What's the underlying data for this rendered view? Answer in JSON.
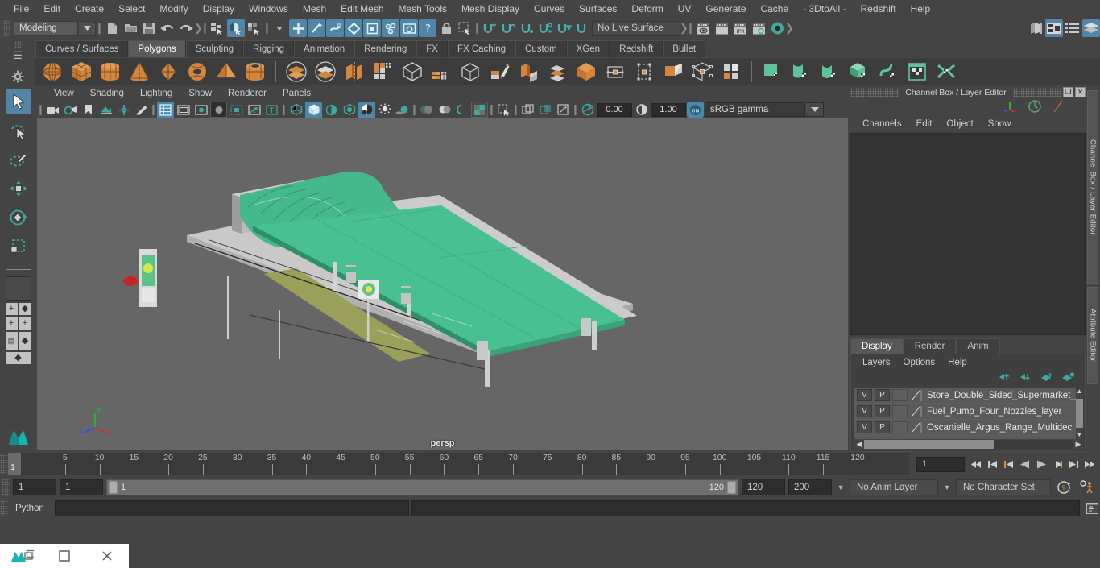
{
  "menubar": {
    "items": [
      "File",
      "Edit",
      "Create",
      "Select",
      "Modify",
      "Display",
      "Windows",
      "Mesh",
      "Edit Mesh",
      "Mesh Tools",
      "Mesh Display",
      "Curves",
      "Surfaces",
      "Deform",
      "UV",
      "Generate",
      "Cache",
      "- 3DtoAll -",
      "Redshift",
      "Help"
    ]
  },
  "statusline": {
    "mode": "Modeling",
    "live_surface": "No Live Surface",
    "icons": [
      "new-scene-icon",
      "open-scene-icon",
      "save-scene-icon",
      "undo-icon",
      "redo-icon",
      "select-hierarchy-icon",
      "select-object-icon",
      "select-component-icon",
      "snap-grid-icon",
      "snap-curve-icon",
      "snap-point-icon",
      "snap-projected-icon",
      "snap-view-plane-icon",
      "magnet-icon",
      "construction-history-icon",
      "lock-icon",
      "make-live-icon",
      "render-current-frame-icon",
      "ipr-render-icon",
      "render-settings-icon",
      "hypershade-icon",
      "render-view-icon",
      "show-hide-editors-icon",
      "channel-box-icon",
      "attribute-editor-icon",
      "tool-settings-icon",
      "modeling-toolkit-icon"
    ]
  },
  "shelf": {
    "tabs": [
      "Curves / Surfaces",
      "Polygons",
      "Sculpting",
      "Rigging",
      "Animation",
      "Rendering",
      "FX",
      "FX Caching",
      "Custom",
      "XGen",
      "Redshift",
      "Bullet"
    ],
    "active_tab": "Polygons",
    "buttons": [
      "poly-sphere-icon",
      "poly-cube-icon",
      "poly-cylinder-icon",
      "poly-cone-icon",
      "poly-plane-icon",
      "poly-torus-icon",
      "poly-pyramid-icon",
      "poly-pipe-icon",
      "boolean-union-icon",
      "boolean-difference-icon",
      "combine-icon",
      "mirror-icon",
      "smooth-icon",
      "extrude-icon",
      "bevel-icon",
      "multicut-icon",
      "bridge-icon",
      "fill-hole-icon",
      "quad-draw-icon",
      "target-weld-icon",
      "append-polygon-icon",
      "insert-edge-loop-icon",
      "offset-edge-loop-icon",
      "connect-icon",
      "detach-icon",
      "duplicate-face-icon",
      "uv-plane-icon",
      "uv-cylinder-icon",
      "uv-sphere-icon",
      "uv-cube-icon",
      "uv-contour-icon",
      "uv-editor-icon",
      "uv-unfold-icon"
    ]
  },
  "toolbox": {
    "tools": [
      "select-tool-icon",
      "lasso-select-tool-icon",
      "paint-select-tool-icon",
      "move-tool-icon",
      "rotate-tool-icon",
      "scale-tool-icon"
    ],
    "selected": "select-tool-icon",
    "layouts": [
      "single-perspective-layout-icon",
      "four-view-layout-icon",
      "outliner-persp-layout-icon",
      "hypergraph-persp-layout-icon"
    ]
  },
  "viewport": {
    "panel_menu": [
      "View",
      "Shading",
      "Lighting",
      "Show",
      "Renderer",
      "Panels"
    ],
    "camera_label": "persp",
    "gamma": "sRGB gamma",
    "exposure": "0.00",
    "contrast": "1.00",
    "axis": {
      "x": "x",
      "y": "y",
      "z": "z"
    },
    "scene_description": "BP petrol station 3D model with green canopy, shop building, fuel pumps and forecourt"
  },
  "channel_box": {
    "title": "Channel Box / Layer Editor",
    "menu": [
      "Channels",
      "Edit",
      "Object",
      "Show"
    ],
    "restore_glyph": "❐",
    "close_glyph": "✕"
  },
  "layer_editor": {
    "tabs": [
      "Display",
      "Render",
      "Anim"
    ],
    "active_tab": "Display",
    "menu": [
      "Layers",
      "Options",
      "Help"
    ],
    "layers": [
      {
        "visible": "V",
        "playback": "P",
        "shading": "",
        "name": "Store_Double_Sided_Supermarket_"
      },
      {
        "visible": "V",
        "playback": "P",
        "shading": "",
        "name": "Fuel_Pump_Four_Nozzles_layer"
      },
      {
        "visible": "V",
        "playback": "P",
        "shading": "",
        "name": "Oscartielle_Argus_Range_Multidec"
      }
    ]
  },
  "edge_tabs": [
    "Channel Box / Layer Editor",
    "Attribute Editor"
  ],
  "timeline": {
    "ticks": [
      5,
      10,
      15,
      20,
      25,
      30,
      35,
      40,
      45,
      50,
      55,
      60,
      65,
      70,
      75,
      80,
      85,
      90,
      95,
      100,
      105,
      110,
      115,
      120
    ],
    "current_frame_marker": "1",
    "current_frame_field": "1",
    "playback_buttons": [
      "go-to-start-icon",
      "step-back-keyframe-icon",
      "step-back-frame-icon",
      "play-backwards-icon",
      "play-forwards-icon",
      "step-forward-frame-icon",
      "step-forward-keyframe-icon",
      "go-to-end-icon"
    ]
  },
  "range": {
    "anim_start": "1",
    "range_start": "1",
    "bar_start_label": "1",
    "bar_end_label": "120",
    "range_end": "120",
    "anim_end": "200",
    "anim_layer": "No Anim Layer",
    "character_set": "No Character Set",
    "auto_key_icon": "auto-keyframe-icon",
    "anim_prefs_icon": "animation-preferences-icon"
  },
  "command_line": {
    "language": "Python",
    "input_value": "",
    "output_value": "",
    "script_editor_icon": "script-editor-icon"
  },
  "taskbar": {
    "items": [
      "maya-app-icon",
      "maximize-icon",
      "close-icon"
    ]
  },
  "colors": {
    "accent_blue": "#5285a6",
    "shelf_orange": "#d9843f",
    "teal": "#3daaa0",
    "canopy_green": "#4fc08a",
    "panel_bg": "#444444",
    "viewport_bg": "#666666"
  }
}
